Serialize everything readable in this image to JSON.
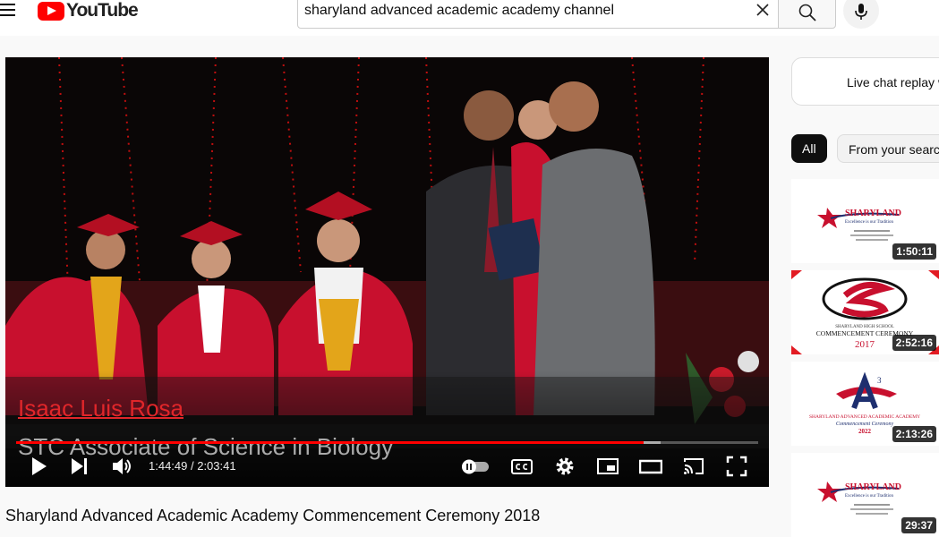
{
  "header": {
    "logo_text": "YouTube",
    "search_value": "sharyland advanced academic academy channel"
  },
  "player": {
    "name_caption": "Isaac Luis Rosa",
    "degree_caption": "STC Associate of Science in Biology",
    "time_display": "1:44:49 / 2:03:41",
    "progress_played_fraction": 0.846,
    "progress_loaded_fraction": 0.869
  },
  "video": {
    "title": "Sharyland Advanced Academic Academy Commencement Ceremony 2018"
  },
  "sidebar": {
    "chat_label": "Live chat replay w",
    "chips": [
      "All",
      "From your searc"
    ],
    "videos": [
      {
        "duration": "1:50:11",
        "brand": "SHARYLAND",
        "sub": "Excellence is our Tradition"
      },
      {
        "duration": "2:52:16",
        "line1": "SHARYLAND HIGH SCHOOL",
        "line2": "COMMENCEMENT CEREMONY",
        "year": "2017"
      },
      {
        "duration": "2:13:26",
        "line1": "SHARYLAND ADVANCED ACADEMIC ACADEMY",
        "line2": "Commencement Ceremony",
        "year": "2022"
      },
      {
        "duration": "29:37",
        "brand": "SHARYLAND",
        "sub": "Excellence is our Tradition"
      }
    ]
  },
  "colors": {
    "accent_red": "#ff0000",
    "gown_red": "#c8102e"
  }
}
